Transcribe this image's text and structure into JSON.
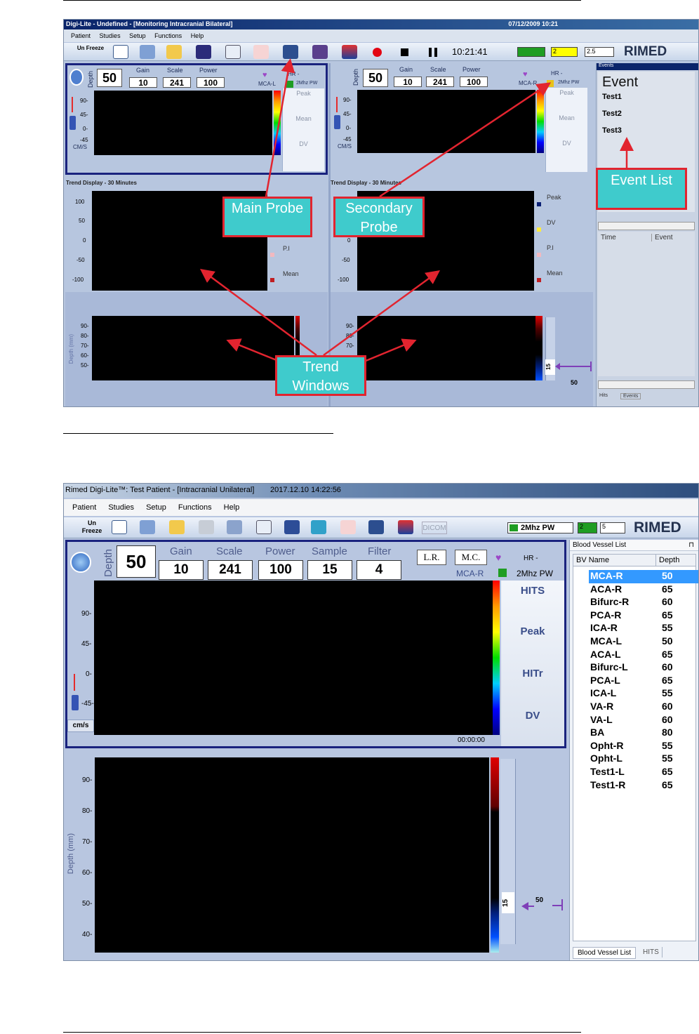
{
  "screen1": {
    "title": "Digi-Lite - Undefined - [Monitoring Intracranial Bilateral]",
    "datetime": "07/12/2009 10:21",
    "menu": [
      "Patient",
      "Studies",
      "Setup",
      "Functions",
      "Help"
    ],
    "unfreeze": "Un Freeze",
    "clock": "10:21:41",
    "combo_a": "2",
    "combo_b": "2.5",
    "logo": "RIMED",
    "probe_main": {
      "depth_label": "Depth",
      "depth": "50",
      "gain_label": "Gain",
      "gain": "10",
      "scale_label": "Scale",
      "scale": "241",
      "power_label": "Power",
      "power": "100",
      "vessel": "MCA-L",
      "hr": "HR -",
      "freq": "2Mhz PW"
    },
    "probe_secondary": {
      "depth_label": "Depth",
      "depth": "50",
      "gain_label": "Gain",
      "gain": "10",
      "scale_label": "Scale",
      "scale": "241",
      "power_label": "Power",
      "power": "100",
      "vessel": "MCA-R",
      "hr": "HR -",
      "freq": "2Mhz PW"
    },
    "spectrum_side": [
      "Peak",
      "Mean",
      "DV"
    ],
    "spectrum_ticks": [
      "90-",
      "45-",
      "0-",
      "-45"
    ],
    "units": "CM/S",
    "trend_title_left": "Trend Display - 30 Minutes",
    "trend_title_right": "Trend Display - 30 Minutes",
    "trend_ticks": [
      "100",
      "50",
      "0",
      "-50",
      "-100"
    ],
    "trend_legend_left": [
      "P.I",
      "Mean"
    ],
    "trend_legend_right": [
      "Peak",
      "DV",
      "P.I",
      "Mean"
    ],
    "depth_ticks": [
      "90-",
      "80-",
      "70-",
      "60-",
      "50-"
    ],
    "depth_ticks_right": [
      "90-",
      "80-",
      "70-"
    ],
    "depth_axis": "Depth (mm)",
    "depth_marker": "15",
    "depth_value": "50",
    "events_panel": {
      "header": "Events",
      "title": "Event",
      "items": [
        "Test1",
        "Test2",
        "Test3"
      ],
      "col_time": "Time",
      "col_event": "Event",
      "tabs": [
        "Hits",
        "Events"
      ]
    },
    "callouts": {
      "main": "Main Probe",
      "secondary": "Secondary Probe",
      "events": "Event List",
      "trend": "Trend Windows"
    }
  },
  "screen2": {
    "title": "Rimed Digi-Lite™: Test Patient - [Intracranial Unilateral]",
    "datetime": "2017.12.10 14:22:56",
    "menu": [
      "Patient",
      "Studies",
      "Setup",
      "Functions",
      "Help"
    ],
    "unfreeze": "Un Freeze",
    "dicom": "DICOM",
    "freq_combo": "2Mhz PW",
    "combo_a": "2",
    "combo_b": "5",
    "logo": "RIMED",
    "probe": {
      "depth_label": "Depth",
      "depth": "50",
      "gain_label": "Gain",
      "gain": "10",
      "scale_label": "Scale",
      "scale": "241",
      "power_label": "Power",
      "power": "100",
      "sample_label": "Sample",
      "sample": "15",
      "filter_label": "Filter",
      "filter": "4",
      "lr": "L.R.",
      "mc": "M.C.",
      "hr": "HR -",
      "vessel": "MCA-R",
      "freq": "2Mhz PW"
    },
    "spectrum_side": [
      "HITS",
      "Peak",
      "HITr",
      "DV"
    ],
    "spectrum_ticks": [
      "90-",
      "45-",
      "0-",
      "-45-"
    ],
    "units": "cm/s",
    "time": "00:00:00",
    "depth_ticks": [
      "90-",
      "80-",
      "70-",
      "60-",
      "50-",
      "40-"
    ],
    "depth_axis": "Depth (mm)",
    "depth_marker": "15",
    "depth_value": "50",
    "bv_panel": {
      "header": "Blood Vessel List",
      "col_name": "BV Name",
      "col_depth": "Depth",
      "rows": [
        {
          "name": "MCA-R",
          "depth": "50"
        },
        {
          "name": "ACA-R",
          "depth": "65"
        },
        {
          "name": "Bifurc-R",
          "depth": "60"
        },
        {
          "name": "PCA-R",
          "depth": "65"
        },
        {
          "name": "ICA-R",
          "depth": "55"
        },
        {
          "name": "MCA-L",
          "depth": "50"
        },
        {
          "name": "ACA-L",
          "depth": "65"
        },
        {
          "name": "Bifurc-L",
          "depth": "60"
        },
        {
          "name": "PCA-L",
          "depth": "65"
        },
        {
          "name": "ICA-L",
          "depth": "55"
        },
        {
          "name": "VA-R",
          "depth": "60"
        },
        {
          "name": "VA-L",
          "depth": "60"
        },
        {
          "name": "BA",
          "depth": "80"
        },
        {
          "name": "Opht-R",
          "depth": "55"
        },
        {
          "name": "Opht-L",
          "depth": "55"
        },
        {
          "name": "Test1-L",
          "depth": "65"
        },
        {
          "name": "Test1-R",
          "depth": "65"
        }
      ],
      "selected_color": "#3399ff",
      "tabs": [
        "Blood Vessel List",
        "HITS"
      ]
    }
  },
  "colors": {
    "callout_fill": "#3fcbcc",
    "callout_border": "#e2242f",
    "frame_blue": "#1a237e"
  }
}
